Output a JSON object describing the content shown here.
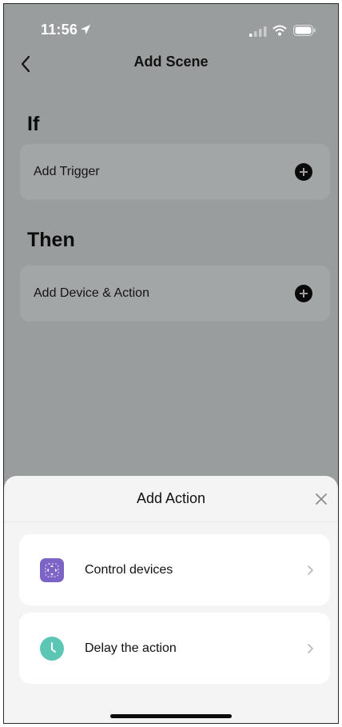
{
  "status_bar": {
    "time": "11:56"
  },
  "nav": {
    "title": "Add Scene"
  },
  "if_section": {
    "heading": "If",
    "card_label": "Add Trigger"
  },
  "then_section": {
    "heading": "Then",
    "card_label": "Add Device & Action"
  },
  "sheet": {
    "title": "Add Action",
    "options": [
      {
        "label": "Control devices",
        "icon": "control-devices-icon"
      },
      {
        "label": "Delay the action",
        "icon": "clock-icon"
      }
    ]
  },
  "colors": {
    "overlay_bg": "#9a9d9e",
    "control_icon": "#7b64c5",
    "delay_icon": "#5cc6b4"
  }
}
